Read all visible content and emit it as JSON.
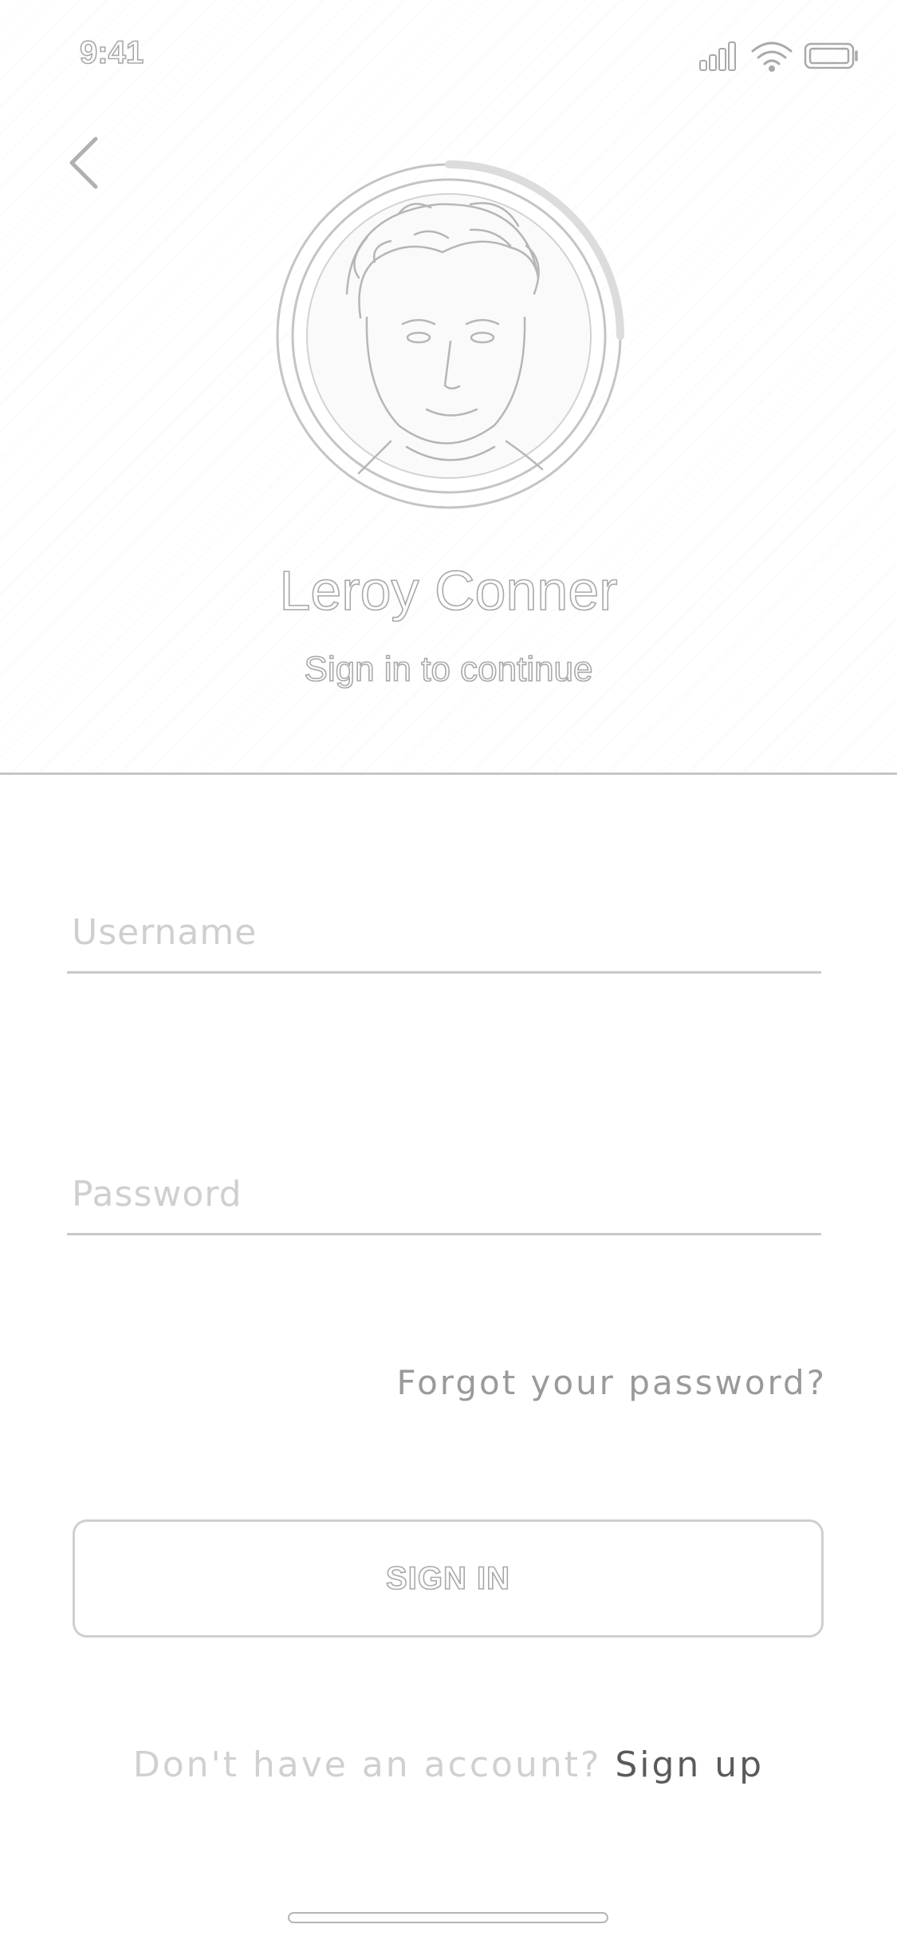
{
  "status_bar": {
    "time": "9:41",
    "icons": [
      "cellular-signal-icon",
      "wifi-icon",
      "battery-icon"
    ]
  },
  "nav": {
    "back_icon": "chevron-left-icon"
  },
  "profile": {
    "name": "Leroy Conner",
    "subtitle": "Sign in to continue"
  },
  "form": {
    "username_placeholder": "Username",
    "username_value": "",
    "password_placeholder": "Password",
    "password_value": ""
  },
  "forgot_password": "Forgot your password?",
  "sign_in_button": "SIGN IN",
  "signup": {
    "prompt": "Don't have an account?",
    "link": "Sign up"
  },
  "colors": {
    "background": "#ffffff",
    "outline": "#a9a9a9",
    "divider": "#c6c6c6",
    "link": "#5a5a5a"
  }
}
